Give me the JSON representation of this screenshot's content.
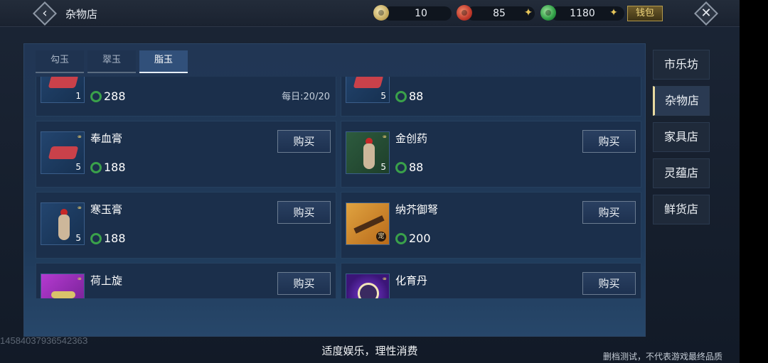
{
  "header": {
    "title": "杂物店",
    "back_icon": "chevron-left-icon",
    "close_icon": "close-icon",
    "wallet_label": "钱包",
    "currencies": [
      {
        "name": "yellow-jade-coin",
        "value": "10",
        "color": "#d8c070"
      },
      {
        "name": "red-coin",
        "value": "85",
        "color": "#c0392b"
      },
      {
        "name": "green-jade-coin",
        "value": "1180",
        "color": "#2f9e45"
      }
    ]
  },
  "tabs": [
    {
      "label": "勾玉",
      "active": false
    },
    {
      "label": "翠玉",
      "active": false
    },
    {
      "label": "脂玉",
      "active": true
    }
  ],
  "items": [
    {
      "name": "",
      "qty": "1",
      "price": "288",
      "limit": "每日:20/20",
      "buy": ""
    },
    {
      "name": "",
      "qty": "5",
      "price": "88",
      "limit": "",
      "buy": ""
    },
    {
      "name": "奉血膏",
      "qty": "5",
      "price": "188",
      "limit": "",
      "buy": "购买"
    },
    {
      "name": "金创药",
      "qty": "5",
      "price": "88",
      "limit": "",
      "buy": "购买"
    },
    {
      "name": "寒玉膏",
      "qty": "5",
      "price": "188",
      "limit": "",
      "buy": "购买"
    },
    {
      "name": "纳芥御弩",
      "qty": "",
      "price": "200",
      "limit": "",
      "buy": "购买",
      "badge": "宠"
    },
    {
      "name": "荷上旋",
      "qty": "",
      "price": "",
      "limit": "",
      "buy": "购买"
    },
    {
      "name": "化育丹",
      "qty": "",
      "price": "",
      "limit": "",
      "buy": "购买"
    }
  ],
  "nav": [
    {
      "label": "市乐坊",
      "active": false
    },
    {
      "label": "杂物店",
      "active": true
    },
    {
      "label": "家具店",
      "active": false
    },
    {
      "label": "灵蕴店",
      "active": false
    },
    {
      "label": "鲜货店",
      "active": false
    }
  ],
  "footer": {
    "watermark_id": "1458403793654236З",
    "notice": "适度娱乐，理性消费",
    "test_note": "删档测试，不代表游戏最终品质"
  }
}
